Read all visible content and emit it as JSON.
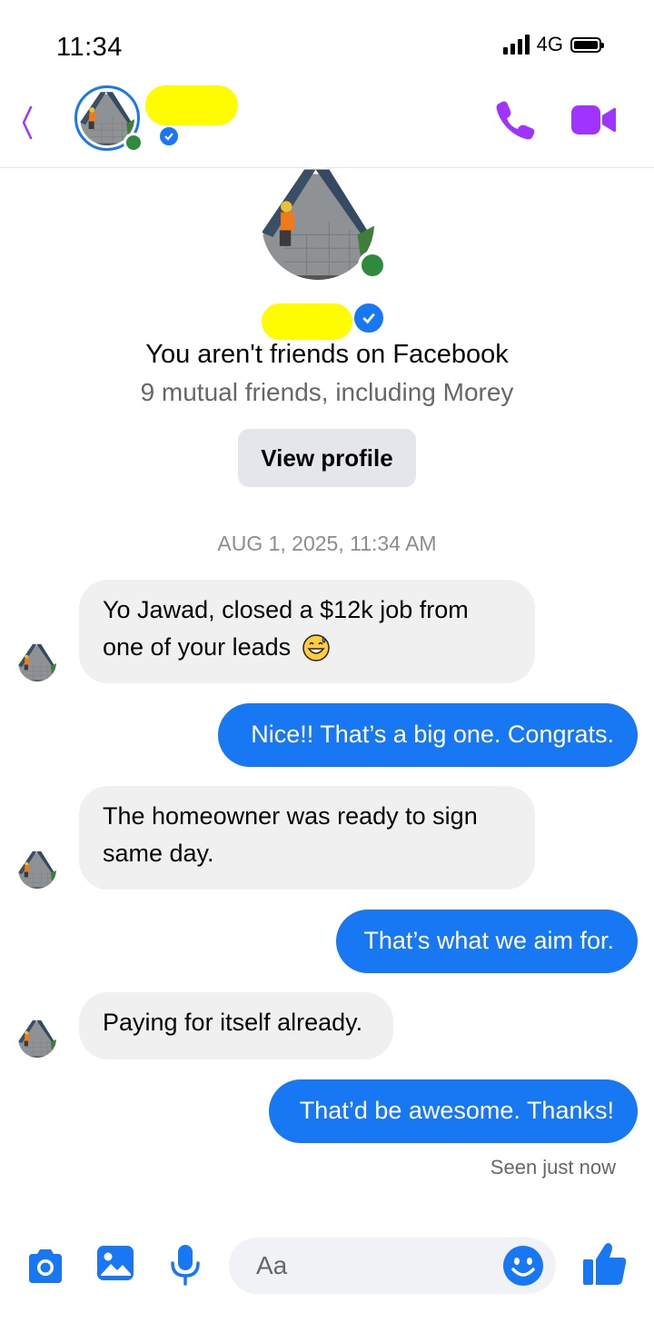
{
  "status_bar": {
    "time": "11:34",
    "network": "4G"
  },
  "header": {
    "contact_name": "",
    "icons": {
      "back": "back-chevron-icon",
      "call": "phone-icon",
      "video": "video-camera-icon",
      "verified": "verified-badge-icon"
    }
  },
  "intro": {
    "title": "You aren't friends on Facebook",
    "subtitle": "9 mutual friends, including Morey",
    "button": "View profile"
  },
  "timestamp": "AUG 1, 2025, 11:34 AM",
  "messages": [
    {
      "direction": "incoming",
      "line1": "Yo Jawad, closed a $12k job from",
      "line2": "one of your leads",
      "emoji": "grinning-sweat-emoji"
    },
    {
      "direction": "outgoing",
      "text": "Nice!! That’s a big one. Congrats."
    },
    {
      "direction": "incoming",
      "line1": "The homeowner was ready to sign",
      "line2": "same day."
    },
    {
      "direction": "outgoing",
      "text": "That’s what we aim for."
    },
    {
      "direction": "incoming",
      "text": "Paying for itself already."
    },
    {
      "direction": "outgoing",
      "text": "That’d be awesome. Thanks!"
    }
  ],
  "seen_status": "Seen just now",
  "composer": {
    "placeholder": "Aa",
    "icons": [
      "camera-icon",
      "gallery-icon",
      "microphone-icon",
      "emoji-icon",
      "thumbs-up-icon"
    ]
  },
  "colors": {
    "accent": "#1877f2",
    "header_icons": "#a033ff",
    "incoming_bubble": "#f0f0f0",
    "online": "#2e8b3e"
  }
}
